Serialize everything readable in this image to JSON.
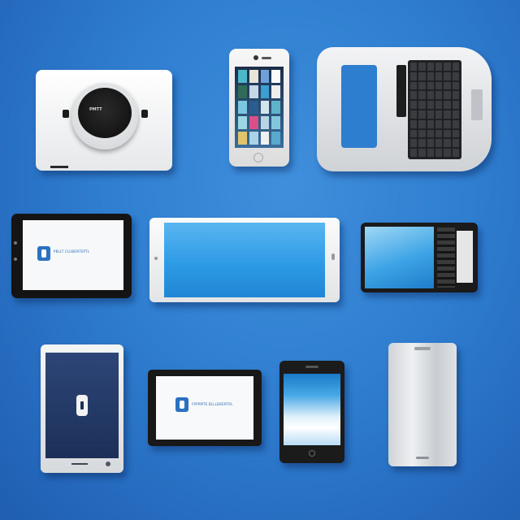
{
  "scene": {
    "background_color": "#2f7ed0",
    "devices": [
      {
        "name": "smart-speaker-dock",
        "icon": "speaker-icon",
        "logo_text": "PMTT"
      },
      {
        "name": "smartphone-app-grid",
        "icon": "phone-icon"
      },
      {
        "name": "laptop-keyboard",
        "icon": "laptop-icon"
      },
      {
        "name": "black-tablet-landscape",
        "icon": "tablet-icon",
        "screen_text": "PBLLT CLUBENTEPTL"
      },
      {
        "name": "white-tablet-blue-screen",
        "icon": "tablet-icon"
      },
      {
        "name": "slider-phone-keyboard",
        "icon": "phone-icon"
      },
      {
        "name": "navy-tablet-portrait",
        "icon": "tablet-icon"
      },
      {
        "name": "small-tablet-landscape",
        "icon": "tablet-icon",
        "screen_text": "FPPPMTE BLLLDKERTRL"
      },
      {
        "name": "black-smartphone",
        "icon": "phone-icon"
      },
      {
        "name": "silver-smartphone-back",
        "icon": "phone-icon"
      }
    ]
  }
}
